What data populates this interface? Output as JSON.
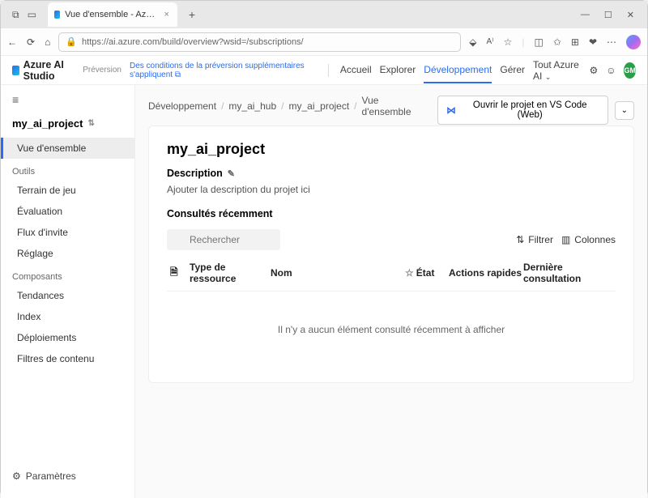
{
  "browser": {
    "tab_title": "Vue d'ensemble - Azure AI Studio",
    "url": "https://ai.azure.com/build/overview?wsid=/subscriptions/"
  },
  "header": {
    "brand": "Azure AI Studio",
    "preversion": "Préversion",
    "preview_link": "Des conditions de la préversion supplémentaires s'appliquent",
    "nav": {
      "home": "Accueil",
      "explore": "Explorer",
      "dev": "Développement",
      "manage": "Gérer"
    },
    "scope": "Tout Azure AI",
    "avatar": "GM"
  },
  "sidebar": {
    "project": "my_ai_project",
    "items": {
      "overview": "Vue d'ensemble",
      "tools_header": "Outils",
      "playground": "Terrain de jeu",
      "evaluation": "Évaluation",
      "promptflow": "Flux d'invite",
      "finetune": "Réglage",
      "components_header": "Composants",
      "trends": "Tendances",
      "index": "Index",
      "deployments": "Déploiements",
      "contentfilters": "Filtres de contenu"
    },
    "settings": "Paramètres"
  },
  "breadcrumbs": {
    "b1": "Développement",
    "b2": "my_ai_hub",
    "b3": "my_ai_project",
    "b4": "Vue d'ensemble"
  },
  "vscode_button": "Ouvrir le projet en VS Code (Web)",
  "content": {
    "title": "my_ai_project",
    "description_label": "Description",
    "description_placeholder": "Ajouter la description du projet ici",
    "recent_label": "Consultés récemment",
    "search_placeholder": "Rechercher",
    "filter_label": "Filtrer",
    "columns_label": "Colonnes",
    "table": {
      "resource_type": "Type de ressource",
      "name": "Nom",
      "state": "État",
      "quick_actions": "Actions rapides",
      "last_viewed": "Dernière consultation"
    },
    "empty": "Il n'y a aucun élément consulté récemment à afficher"
  }
}
